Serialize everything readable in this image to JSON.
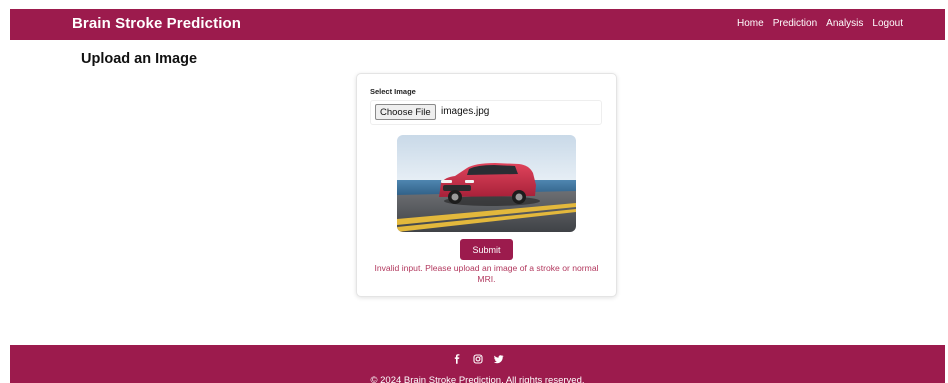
{
  "header": {
    "brand": "Brain Stroke Prediction",
    "nav": [
      "Home",
      "Prediction",
      "Analysis",
      "Logout"
    ]
  },
  "main": {
    "title": "Upload an Image",
    "form": {
      "select_label": "Select Image",
      "file_button": "Choose File",
      "file_name": "images.jpg",
      "submit_label": "Submit",
      "error_message": "Invalid input. Please upload an image of a stroke or normal MRI."
    },
    "preview_image": "red-suv-on-road-photo"
  },
  "footer": {
    "social_icons": [
      "facebook-icon",
      "instagram-icon",
      "twitter-icon"
    ],
    "copyright": "© 2024 Brain Stroke Prediction. All rights reserved."
  },
  "colors": {
    "brand": "#9c1b4d",
    "error": "#b2385e",
    "background": "#ffffff"
  }
}
